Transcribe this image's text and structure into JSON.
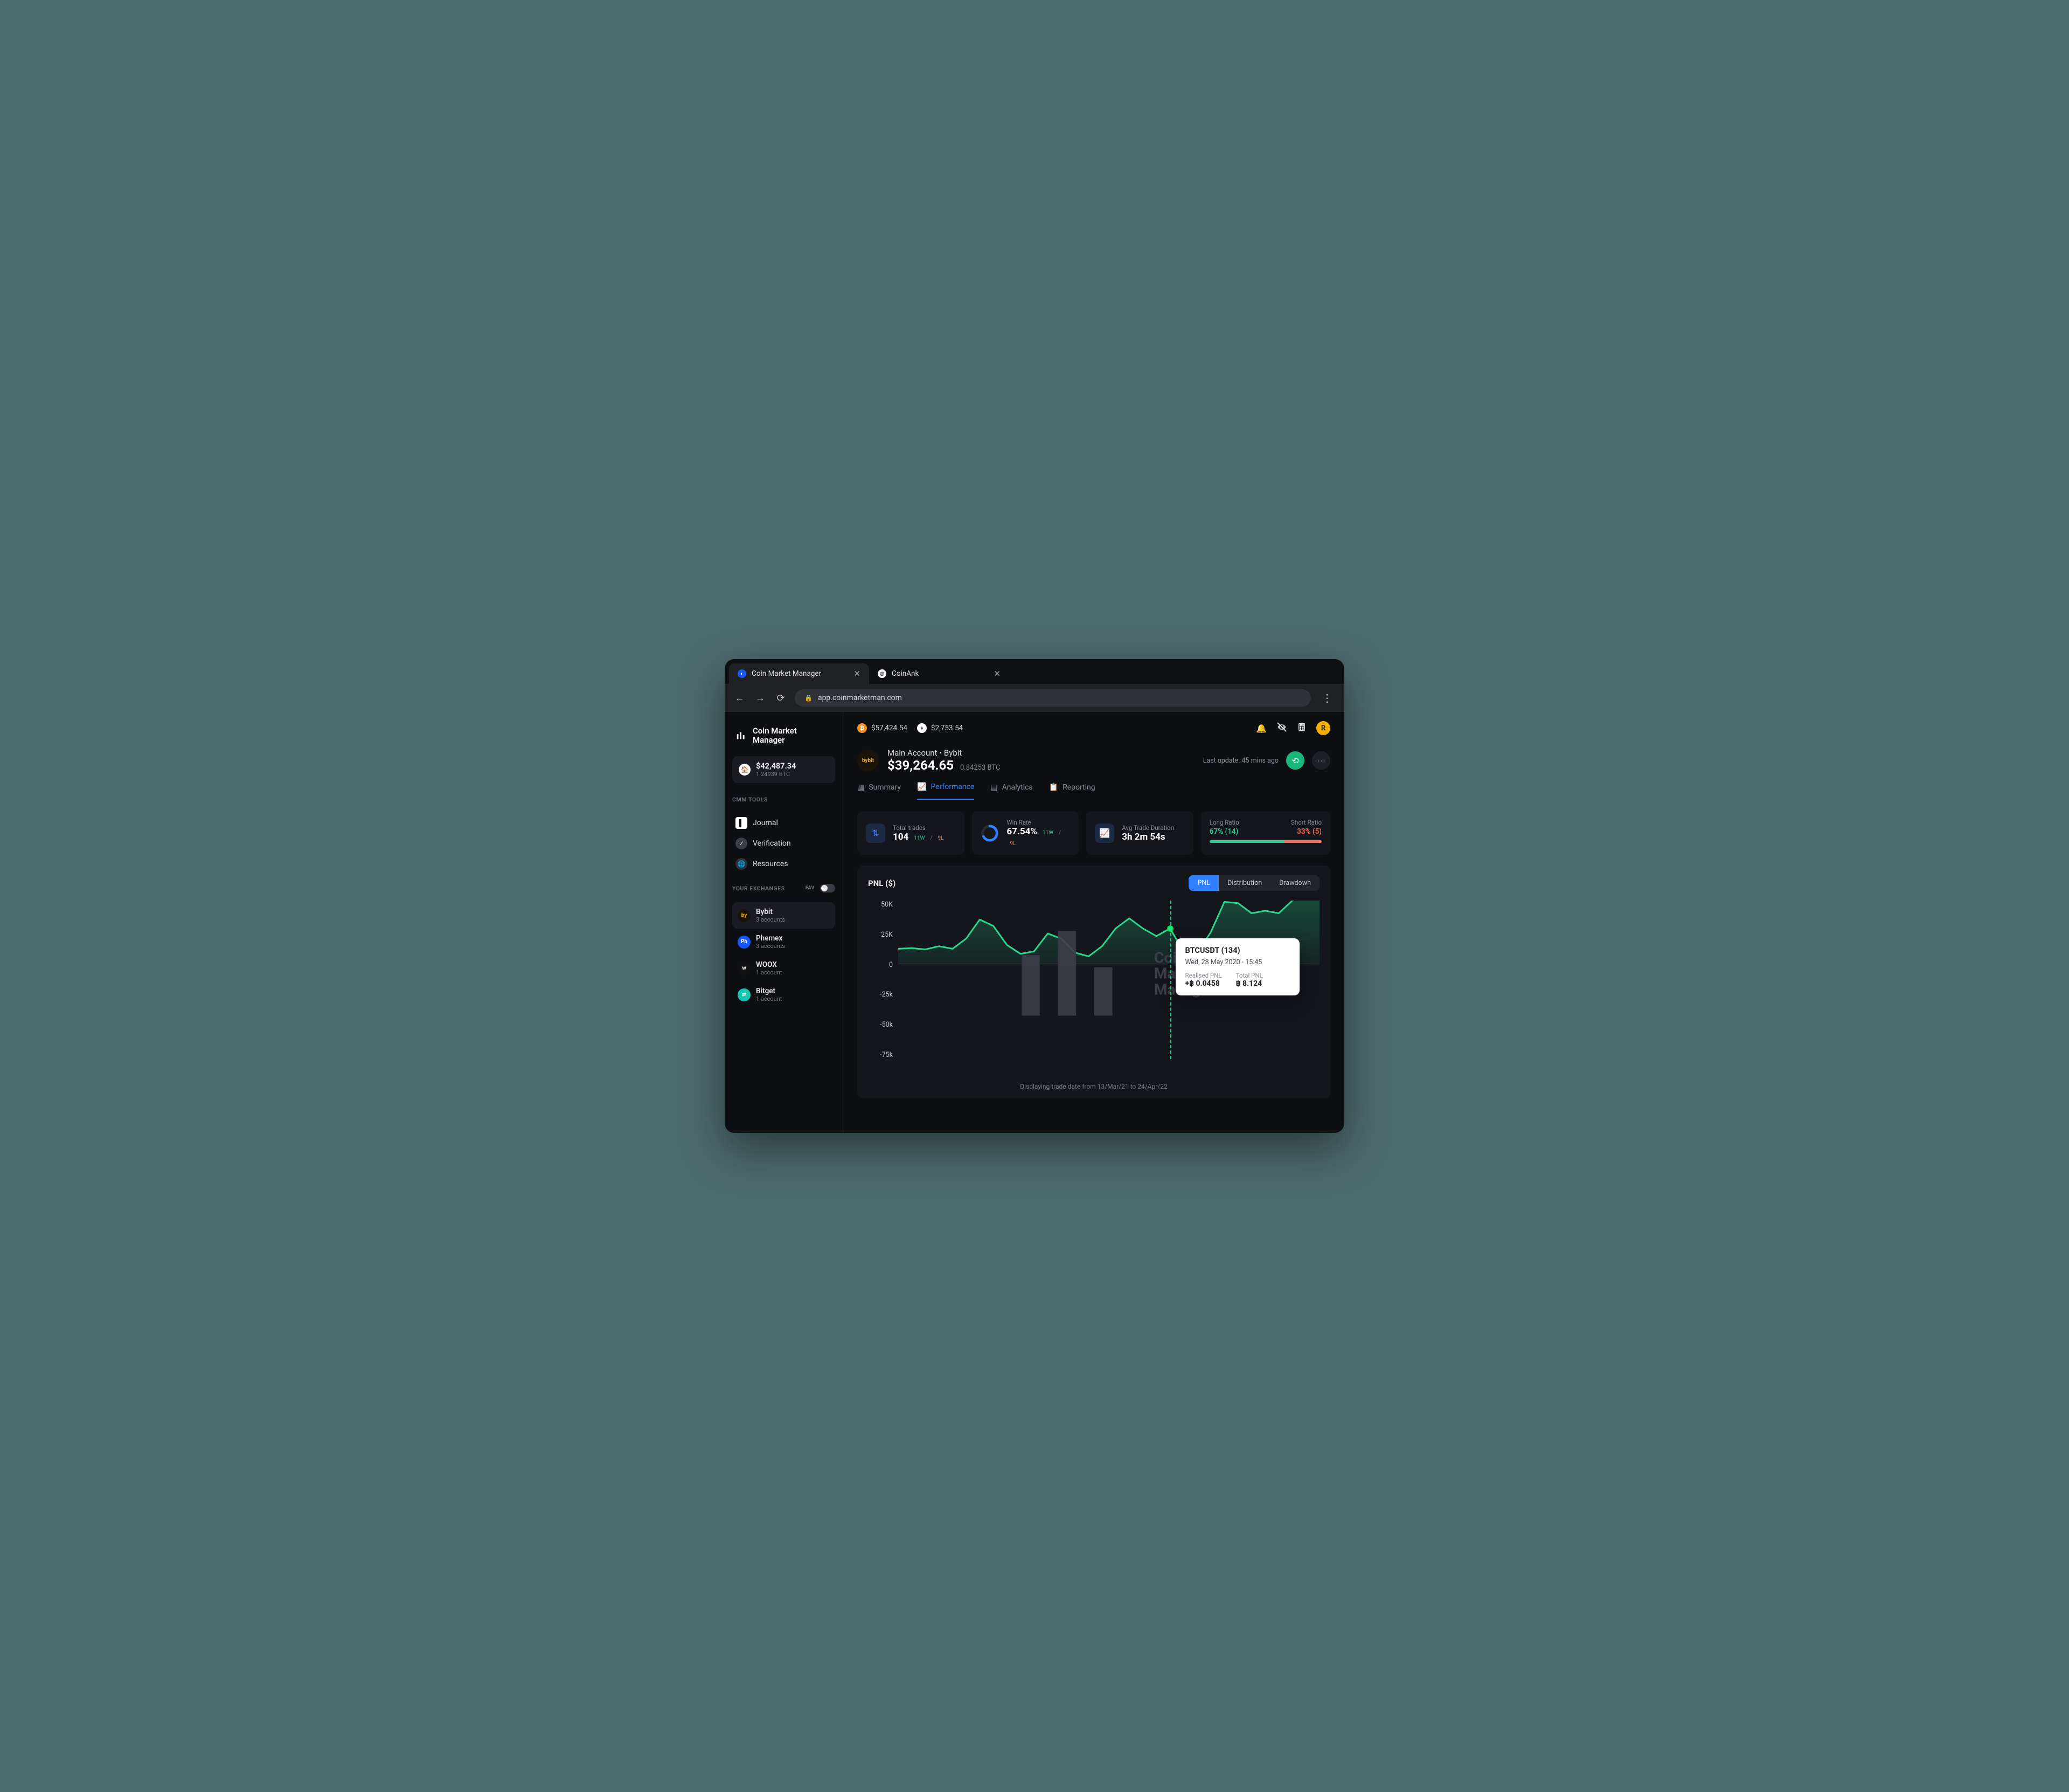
{
  "browser": {
    "tabs": [
      {
        "title": "Coin Market Manager",
        "active": true
      },
      {
        "title": "CoinAnk",
        "active": false
      }
    ],
    "url": "app.coinmarketman.com"
  },
  "brand": "Coin Market\nManager",
  "balance": {
    "usd": "$42,487.34",
    "btc": "1.24939 BTC"
  },
  "prices": {
    "btc": "$57,424.54",
    "eth": "$2,753.54"
  },
  "sidebar": {
    "tools_label": "CMM TOOLS",
    "items": [
      {
        "label": "Journal"
      },
      {
        "label": "Verification"
      },
      {
        "label": "Resources"
      }
    ],
    "exchanges_label": "YOUR EXCHANGES",
    "fav_label": "FAV",
    "exchanges": [
      {
        "name": "Bybit",
        "sub": "3 accounts",
        "active": true,
        "color": "#1a1307",
        "fg": "#f0a918",
        "abbr": "by"
      },
      {
        "name": "Phemex",
        "sub": "3 accounts",
        "active": false,
        "color": "#1557ff",
        "fg": "#fff",
        "abbr": "Ph"
      },
      {
        "name": "WOOX",
        "sub": "1 account",
        "active": false,
        "color": "#111",
        "fg": "#fff",
        "abbr": "w"
      },
      {
        "name": "Bitget",
        "sub": "1 account",
        "active": false,
        "color": "#14c7b5",
        "fg": "#fff",
        "abbr": "⇄"
      }
    ]
  },
  "account": {
    "title": "Main Account  •  Bybit",
    "usd": "$39,264.65",
    "btc": "0.84253 BTC",
    "last_update": "Last update: 45 mins ago"
  },
  "tabs": [
    "Summary",
    "Performance",
    "Analytics",
    "Reporting"
  ],
  "active_tab": 1,
  "cards": {
    "total_trades": {
      "label": "Total trades",
      "value": "104",
      "wins": "11W",
      "losses": "9L"
    },
    "win_rate": {
      "label": "Win Rate",
      "value": "67.54%",
      "wins": "11W",
      "losses": "9L"
    },
    "avg_duration": {
      "label": "Avg Trade Duration",
      "value": "3h 2m 54s"
    },
    "ratio": {
      "long_label": "Long Ratio",
      "long_value": "67%",
      "long_count": "(14)",
      "short_label": "Short Ratio",
      "short_value": "33%",
      "short_count": "(5)",
      "long_pct": 67
    }
  },
  "chart": {
    "title": "PNL ($)",
    "segments": [
      "PNL",
      "Distribution",
      "Drawdown"
    ],
    "active_segment": 0,
    "footer": "Displaying trade date from 13/Mar/21 to 24/Apr/22",
    "tooltip": {
      "pair": "BTCUSDT (134)",
      "timestamp": "Wed, 28 May 2020 - 15:45",
      "realised_label": "Realised PNL",
      "realised_value": "+฿ 0.0458",
      "total_label": "Total PNL",
      "total_value": "฿ 8.124"
    }
  },
  "topbar_avatar": "R",
  "chart_data": {
    "type": "line",
    "title": "PNL ($)",
    "ylabel": "",
    "ylim": [
      -75000,
      50000
    ],
    "y_ticks": [
      "50K",
      "25K",
      "0",
      "-25k",
      "-50k",
      "-75k"
    ],
    "x_range": [
      "13/Mar/21",
      "24/Apr/22"
    ],
    "series": [
      {
        "name": "PNL",
        "values": [
          12000,
          12500,
          11500,
          14000,
          12000,
          20000,
          35000,
          30000,
          15000,
          8000,
          10000,
          24000,
          20000,
          9000,
          6000,
          14000,
          28000,
          36000,
          28000,
          22000,
          28000,
          10000,
          9000,
          25000,
          49000,
          48000,
          40000,
          42000,
          40000,
          50000,
          56000,
          55000
        ]
      }
    ],
    "cursor_index": 20,
    "cursor_value": 28000
  }
}
